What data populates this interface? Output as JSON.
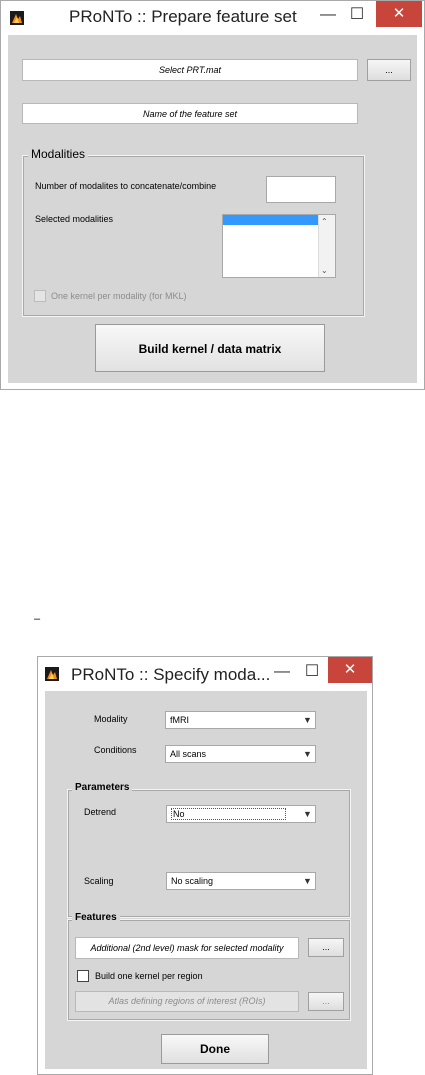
{
  "win1": {
    "title": "PRoNTo :: Prepare feature set",
    "controls": {
      "minimize": "—",
      "maximize": "☐",
      "close": "✕"
    },
    "select_field": "Select PRT.mat",
    "browse_button": "...",
    "name_field": "Name of the feature set",
    "modalities": {
      "legend": "Modalities",
      "num_label": "Number of modalites to concatenate/combine",
      "num_value": "",
      "selected_label": "Selected modalities",
      "kernel_checkbox": "One kernel per modality (for MKL)"
    },
    "build_button": "Build kernel / data matrix"
  },
  "stray_mark": "–",
  "win2": {
    "title": "PRoNTo :: Specify moda...",
    "controls": {
      "minimize": "—",
      "maximize": "☐",
      "close": "✕"
    },
    "modality_label": "Modality",
    "modality_value": "fMRI",
    "conditions_label": "Conditions",
    "conditions_value": "All scans",
    "parameters": {
      "legend": "Parameters",
      "detrend_label": "Detrend",
      "detrend_value": "No",
      "scaling_label": "Scaling",
      "scaling_value": "No scaling"
    },
    "features": {
      "legend": "Features",
      "mask_field": "Additional (2nd level) mask for selected modality",
      "mask_browse": "...",
      "region_checkbox": "Build one kernel per region",
      "atlas_field": "Atlas defining regions of interest (ROIs)",
      "atlas_browse": "..."
    },
    "done_button": "Done"
  },
  "colors": {
    "panel": "#d6d6d6",
    "close": "#c7453a",
    "selection": "#3399ff"
  }
}
